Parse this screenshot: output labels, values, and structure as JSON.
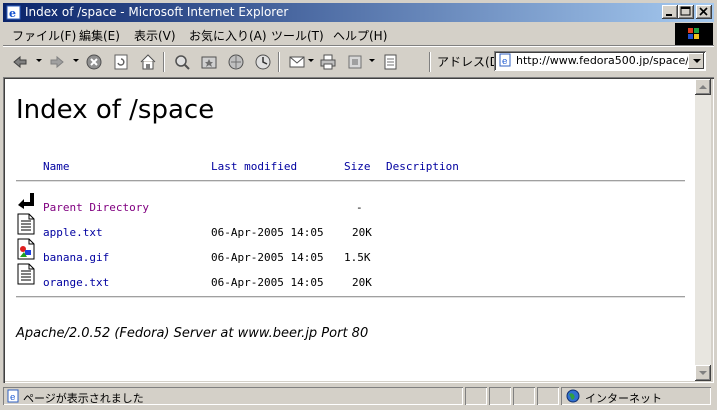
{
  "window": {
    "title": "Index of /space - Microsoft Internet Explorer",
    "minimize": "_",
    "maximize": "□",
    "close": "×"
  },
  "menu": [
    "ファイル(F)",
    "編集(E)",
    "表示(V)",
    "お気に入り(A)",
    "ツール(T)",
    "ヘルプ(H)"
  ],
  "toolbar": {
    "icons": [
      "back-icon",
      "forward-icon",
      "stop-icon",
      "refresh-icon",
      "home-icon",
      "search-icon",
      "favorites-icon",
      "history-icon",
      "media-icon",
      "mail-icon",
      "print-icon",
      "edit-icon",
      "discuss-icon"
    ],
    "address_label": "アドレス(D)",
    "address_value": "http://www.fedora500.jp/space/"
  },
  "page": {
    "heading": "Index of /space",
    "columns": {
      "name": "Name",
      "modified": "Last modified",
      "size": "Size",
      "description": "Description"
    },
    "rows": [
      {
        "icon": "back-arrow-icon",
        "name": "Parent Directory",
        "modified": "",
        "size": "-",
        "visited": true
      },
      {
        "icon": "text-file-icon",
        "name": "apple.txt",
        "modified": "06-Apr-2005 14:05",
        "size": "20K",
        "visited": false
      },
      {
        "icon": "image-file-icon",
        "name": "banana.gif",
        "modified": "06-Apr-2005 14:05",
        "size": "1.5K",
        "visited": false
      },
      {
        "icon": "text-file-icon",
        "name": "orange.txt",
        "modified": "06-Apr-2005 14:05",
        "size": "20K",
        "visited": false
      }
    ],
    "footer": "Apache/2.0.52 (Fedora) Server at www.beer.jp Port 80"
  },
  "status": {
    "message": "ページが表示されました",
    "zone": "インターネット"
  },
  "colors": {
    "link": "#0000a0",
    "visited": "#800080",
    "titlebar_start": "#0a246a",
    "titlebar_end": "#a6caf0"
  }
}
